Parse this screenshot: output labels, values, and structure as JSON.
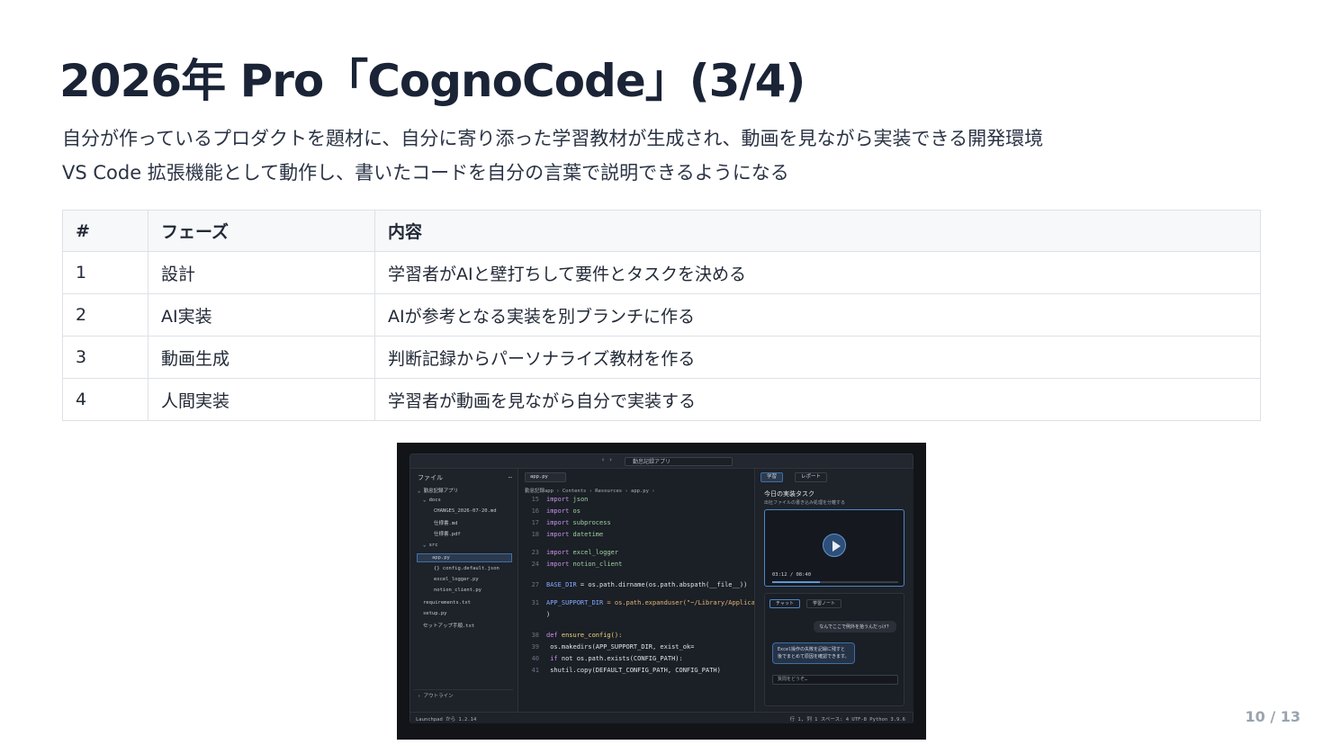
{
  "slide": {
    "title": "2026年 Pro「CognoCode」(3/4)",
    "subtitle_1": "自分が作っているプロダクトを題材に、自分に寄り添った学習教材が生成され、動画を見ながら実装できる開発環境",
    "subtitle_2": "VS Code 拡張機能として動作し、書いたコードを自分の言葉で説明できるようになる",
    "page_number": "10 / 13"
  },
  "table": {
    "headers": [
      "#",
      "フェーズ",
      "内容"
    ],
    "rows": [
      [
        "1",
        "設計",
        "学習者がAIと壁打ちして要件とタスクを決める"
      ],
      [
        "2",
        "AI実装",
        "AIが参考となる実装を別ブランチに作る"
      ],
      [
        "3",
        "動画生成",
        "判断記録からパーソナライズ教材を作る"
      ],
      [
        "4",
        "人間実装",
        "学習者が動画を見ながら自分で実装する"
      ]
    ]
  },
  "screenshot": {
    "nav": "‹ ›",
    "search": "勤怠記録アプリ",
    "sidebar": {
      "header": "ファイル",
      "more": "…",
      "items": [
        "⌄ 勤怠記録アプリ",
        "⌄ docs",
        "CHANGES_2026-07-20.md",
        "仕様書.md",
        "仕様書.pdf",
        "⌄ src",
        "app.py",
        "{} config.default.json",
        "excel_logger.py",
        "notion_client.py",
        "requirements.txt",
        "setup.py",
        "セットアップ手順.txt"
      ],
      "outline": "› アウトライン"
    },
    "editor": {
      "tab": "app.py",
      "breadcrumb": "勤怠記録app › Contents › Resources › app.py ›",
      "lines": [
        {
          "n": "15",
          "a": "import ",
          "b": "json"
        },
        {
          "n": "16",
          "a": "import ",
          "b": "os"
        },
        {
          "n": "17",
          "a": "import ",
          "b": "subprocess"
        },
        {
          "n": "18",
          "a": "import ",
          "b": "datetime"
        },
        {
          "n": "23",
          "a": "import ",
          "b": "excel_logger"
        },
        {
          "n": "24",
          "a": "import ",
          "b": "notion_client"
        },
        {
          "n": "27",
          "a": "BASE_DIR",
          "b": " = os.path.dirname(os.path.abspath(__file__))"
        },
        {
          "n": "31",
          "a": "APP_SUPPORT_DIR",
          "b": " = os.path.expanduser(\"~/Library/Applica"
        },
        {
          "n": "",
          "a": "",
          "b": ")"
        },
        {
          "n": "38",
          "a": "def ",
          "b": "ensure_config():"
        },
        {
          "n": "39",
          "a": "    ",
          "b": "os.makedirs(APP_SUPPORT_DIR, exist_ok="
        },
        {
          "n": "40",
          "a": "    if ",
          "b": "not os.path.exists(CONFIG_PATH):"
        },
        {
          "n": "41",
          "a": "        ",
          "b": "shutil.copy(DEFAULT_CONFIG_PATH, CONFIG_PATH)"
        }
      ]
    },
    "panel": {
      "tab_active": "学習",
      "tab_other": "レポート",
      "title": "今日の実装タスク",
      "desc": "出社ファイルの書き込み処理を分離する",
      "video_time": "03:12 / 08:40",
      "video_progress": 0.38,
      "chat_tab_active": "チャット",
      "chat_tab_other": "学習ノート",
      "bubble_user": "なんでここで例外を拾うんだっけ？",
      "bubble_ai_1": "Excel操作の失敗を記録に残すと",
      "bubble_ai_2": "後でまとめて原因を確認できます。",
      "input_placeholder": "質問をどうぞ…"
    },
    "status_left": "Launchpad から 1.2.14",
    "status_right": "行 1, 列 1  スペース: 4  UTF-8  Python 3.9.6"
  }
}
